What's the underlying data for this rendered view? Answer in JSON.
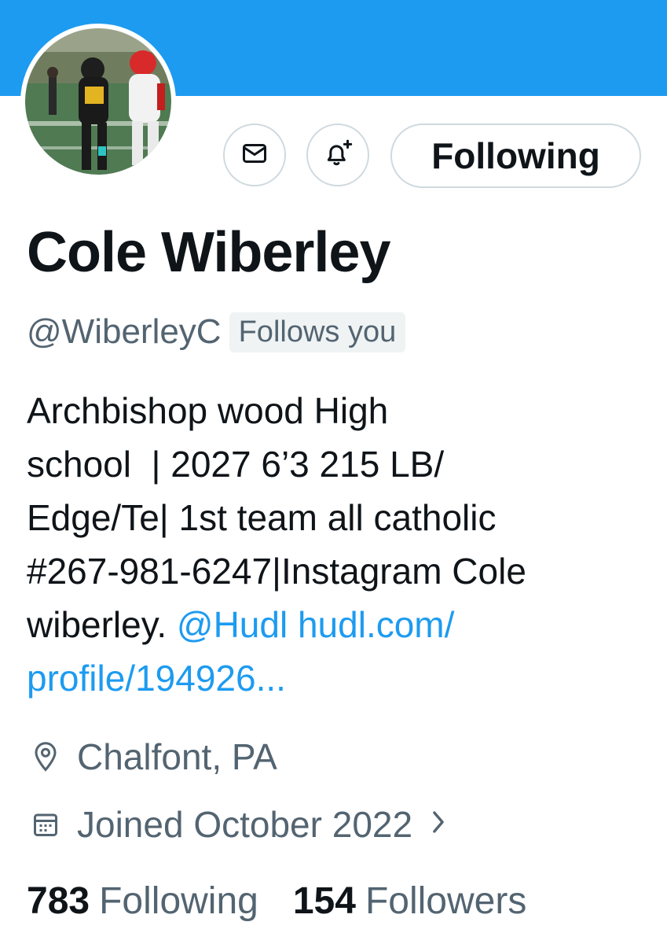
{
  "profile": {
    "display_name": "Cole Wiberley",
    "handle": "@WiberleyC",
    "follows_you": "Follows you",
    "bio_lines": [
      "Archbishop wood High",
      "school  | 2027 6’3 215 LB/",
      "Edge/Te| 1st team all catholic",
      "#267-981-6247|Instagram Cole",
      "wiberley. "
    ],
    "bio_mention": "@Hudl",
    "bio_link_part1": "hudl.com/",
    "bio_link_part2": "profile/194926...",
    "location": "Chalfont, PA",
    "joined": "Joined October 2022"
  },
  "actions": {
    "following_label": "Following",
    "message_icon": "envelope-icon",
    "notify_icon": "bell-plus-icon"
  },
  "stats": {
    "following_count": "783",
    "following_label": "Following",
    "followers_count": "154",
    "followers_label": "Followers"
  },
  "colors": {
    "banner": "#1d9bf0",
    "link": "#1d9bf0",
    "secondary_text": "#536471",
    "primary_text": "#0f1419"
  }
}
